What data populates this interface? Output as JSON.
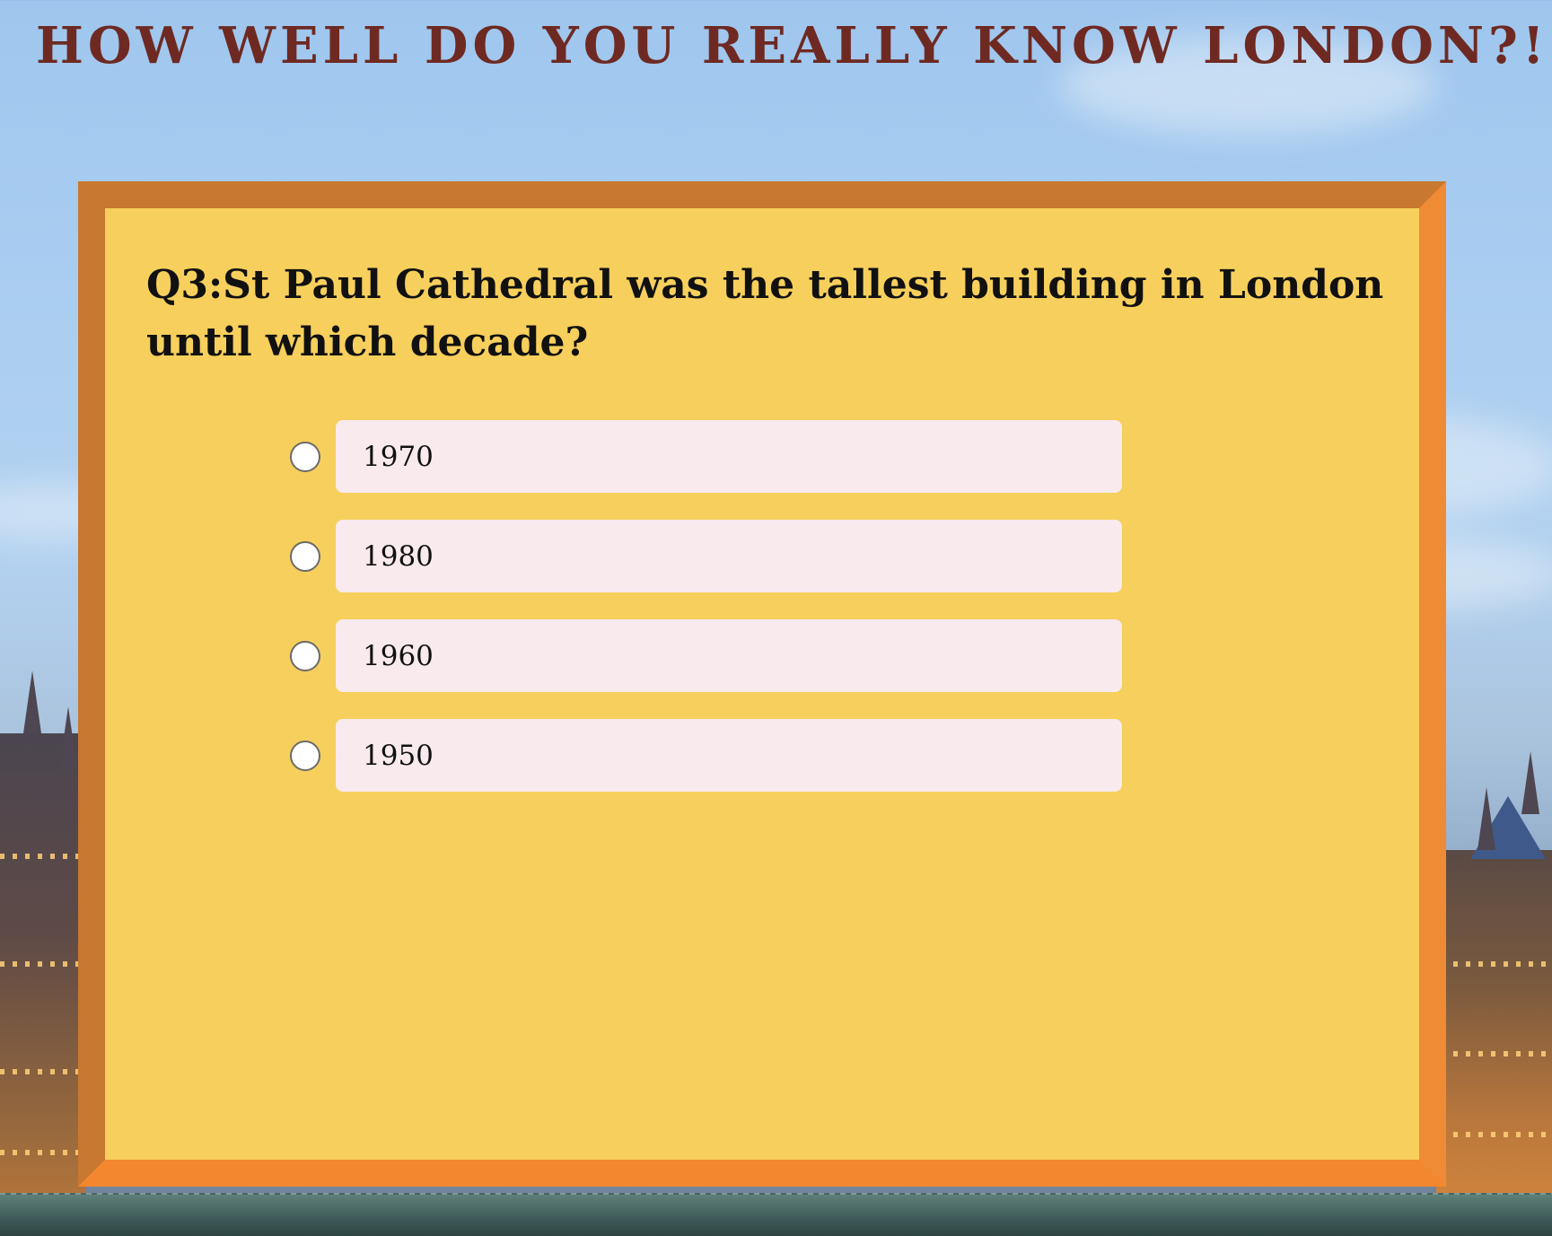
{
  "header": {
    "title": "HOW WELL DO YOU REALLY KNOW LONDON?!!"
  },
  "quiz": {
    "question": "Q3:St Paul Cathedral was the tallest building in London until which decade?",
    "answers": [
      {
        "label": "1970",
        "selected": false
      },
      {
        "label": "1980",
        "selected": false
      },
      {
        "label": "1960",
        "selected": false
      },
      {
        "label": "1950",
        "selected": false
      }
    ]
  },
  "colors": {
    "title": "#6e2a22",
    "card_background": "#f7cf5c",
    "frame_outer": "#f3872f",
    "frame_inner": "#c8782f",
    "answer_background": "#f8eaed"
  },
  "background": {
    "scene": "london-skyline-houses-of-parliament"
  }
}
